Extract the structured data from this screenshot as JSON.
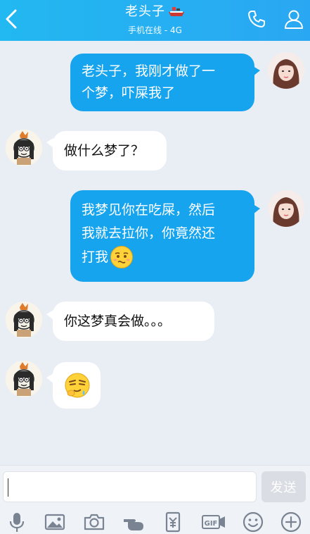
{
  "header": {
    "title": "老头子",
    "status": "手机在线 - 4G",
    "accent": "#22b8f1"
  },
  "messages": [
    {
      "side": "out",
      "text_lines": [
        "老头子，我刚才做了一",
        "个梦，吓屎我了"
      ]
    },
    {
      "side": "in",
      "text": "做什么梦了？"
    },
    {
      "side": "out",
      "text_lines": [
        "我梦见你在吃屎，然后",
        "我就去拉你，你竟然还",
        "打我"
      ],
      "emoji": "awkward-face"
    },
    {
      "side": "in",
      "text": "你这梦真会做。。。"
    },
    {
      "side": "in",
      "emoji": "sly-face"
    }
  ],
  "input": {
    "value": "",
    "send_label": "发送"
  },
  "toolbar": {
    "icons": [
      "microphone-icon",
      "image-icon",
      "camera-icon",
      "poke-icon",
      "red-packet-icon",
      "gif-icon",
      "emoji-icon",
      "plus-icon"
    ]
  },
  "colors": {
    "out_bubble": "#16a4ee",
    "in_bubble": "#ffffff",
    "background": "#e9eef5"
  }
}
